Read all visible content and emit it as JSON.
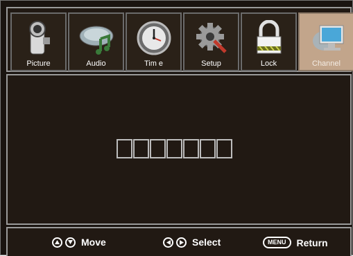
{
  "tabs": [
    {
      "label": "Picture",
      "icon": "camcorder-icon",
      "active": false
    },
    {
      "label": "Audio",
      "icon": "audio-icon",
      "active": false
    },
    {
      "label": "Tim e",
      "icon": "clock-icon",
      "active": false
    },
    {
      "label": "Setup",
      "icon": "gear-icon",
      "active": false
    },
    {
      "label": "Lock",
      "icon": "padlock-icon",
      "active": false
    },
    {
      "label": "Channel",
      "icon": "monitor-icon",
      "active": true
    }
  ],
  "pin": {
    "digits": [
      "",
      "",
      "",
      "",
      "",
      "",
      ""
    ]
  },
  "footer": {
    "move_label": "Move",
    "select_label": "Select",
    "menu_key": "MENU",
    "return_label": "Return"
  },
  "colors": {
    "background": "#211913",
    "active_tab": "#c2a58b",
    "border": "#9a9a9a"
  }
}
